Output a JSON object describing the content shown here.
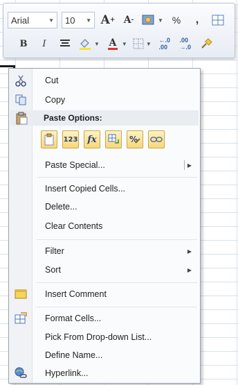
{
  "toolbar": {
    "font_name": "Arial",
    "font_size": "10",
    "percent": "%",
    "comma": ",",
    "bold": "B",
    "italic": "I",
    "grow_font": "A",
    "shrink_font": "A",
    "font_color_letter": "A"
  },
  "colors": {
    "accent": "#f5d77a",
    "menu_bg": "#fafbfd",
    "highlight_bg": "#e9ecf1",
    "font_color_underline": "#e2312b",
    "fill_color_underline": "#ffdf3a"
  },
  "menu": {
    "cut": "Cut",
    "copy": "Copy",
    "paste_options_header": "Paste Options:",
    "paste_special": "Paste Special...",
    "insert_copied_cells": "Insert Copied Cells...",
    "delete": "Delete...",
    "clear_contents": "Clear Contents",
    "filter": "Filter",
    "sort": "Sort",
    "insert_comment": "Insert Comment",
    "format_cells": "Format Cells...",
    "pick_from_dropdown": "Pick From Drop-down List...",
    "define_name": "Define Name...",
    "hyperlink": "Hyperlink..."
  },
  "paste_options": {
    "values_label": "123",
    "formulas_label": "fx"
  },
  "icons": {
    "cut": "scissors-icon",
    "copy": "copy-icon",
    "paste": "clipboard-icon",
    "insert_comment": "comment-icon",
    "format_cells": "format-cells-icon",
    "hyperlink": "hyperlink-icon",
    "submenu": "triangle-right-icon"
  }
}
